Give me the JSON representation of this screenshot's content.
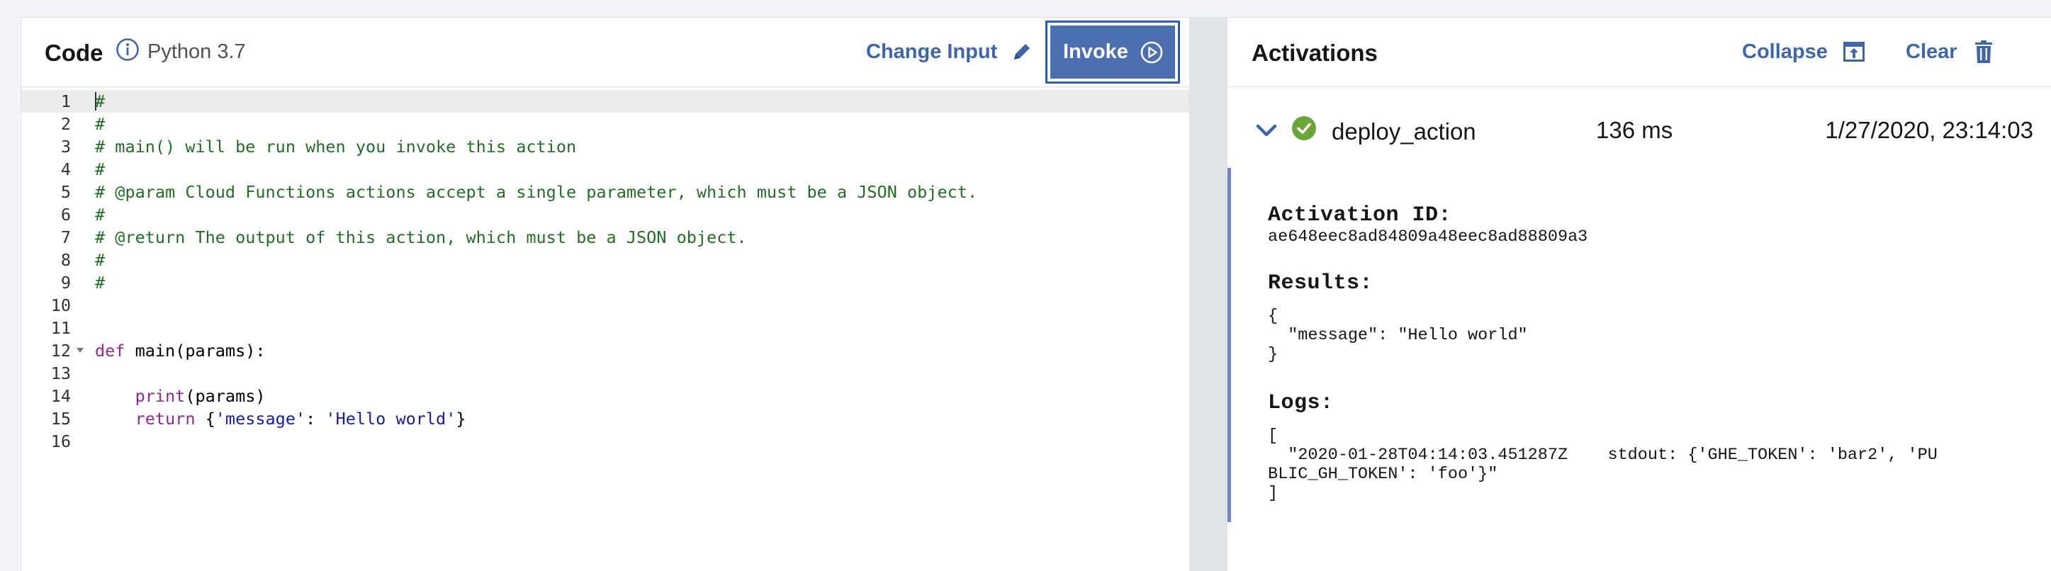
{
  "code_panel": {
    "title": "Code",
    "runtime": "Python 3.7",
    "change_input_label": "Change Input",
    "invoke_label": "Invoke"
  },
  "editor": {
    "lines": [
      {
        "n": "1",
        "text": "#"
      },
      {
        "n": "2",
        "text": "#"
      },
      {
        "n": "3",
        "text": "# main() will be run when you invoke this action"
      },
      {
        "n": "4",
        "text": "#"
      },
      {
        "n": "5",
        "text": "# @param Cloud Functions actions accept a single parameter, which must be a JSON object."
      },
      {
        "n": "6",
        "text": "#"
      },
      {
        "n": "7",
        "text": "# @return The output of this action, which must be a JSON object."
      },
      {
        "n": "8",
        "text": "#"
      },
      {
        "n": "9",
        "text": "#"
      },
      {
        "n": "10",
        "text": ""
      },
      {
        "n": "11",
        "text": ""
      },
      {
        "n": "12",
        "text": "def main(params):"
      },
      {
        "n": "13",
        "text": ""
      },
      {
        "n": "14",
        "text": "    print(params)"
      },
      {
        "n": "15",
        "text": "    return {'message': 'Hello world'}"
      },
      {
        "n": "16",
        "text": ""
      }
    ]
  },
  "activations": {
    "title": "Activations",
    "collapse_label": "Collapse",
    "clear_label": "Clear",
    "items": [
      {
        "action_name": "deploy_action",
        "duration": "136 ms",
        "timestamp": "1/27/2020, 23:14:03",
        "status": "success",
        "activation_id_label": "Activation ID:",
        "activation_id": "ae648eec8ad84809a48eec8ad88809a3",
        "results_label": "Results:",
        "results_text": "{\n  \"message\": \"Hello world\"\n}",
        "logs_label": "Logs:",
        "logs_text": "[\n  \"2020-01-28T04:14:03.451287Z    stdout: {'GHE_TOKEN': 'bar2', 'PU\nBLIC_GH_TOKEN': 'foo'}\"\n]"
      }
    ]
  },
  "colors": {
    "accent": "#3f66a8",
    "invoke_bg": "#4b6fb0",
    "success": "#6aa53a",
    "comment": "#236e25",
    "keyword": "#93268f",
    "string": "#1a1aa6"
  }
}
